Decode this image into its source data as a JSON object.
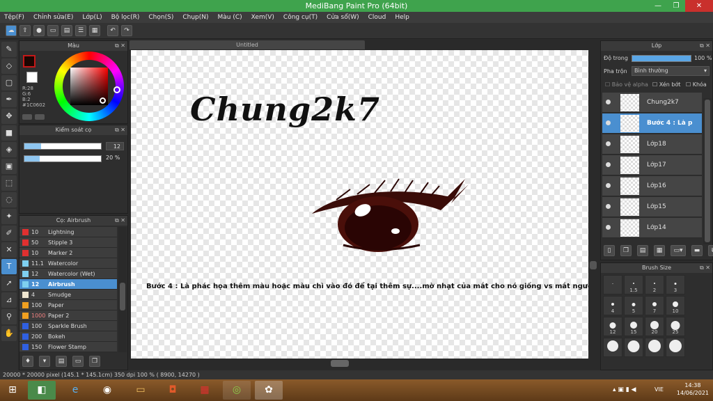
{
  "window": {
    "title": "MediBang Paint Pro (64bit)",
    "min": "—",
    "max": "❐",
    "close": "✕"
  },
  "menu": [
    "Tệp(F)",
    "Chỉnh sửa(E)",
    "Lớp(L)",
    "Bộ lọc(R)",
    "Chọn(S)",
    "Chụp(N)",
    "Màu (C)",
    "Xem(V)",
    "Công cụ(T)",
    "Cửa sổ(W)",
    "Cloud",
    "Help"
  ],
  "toolbar_icons": [
    "cloud-icon",
    "share-icon",
    "comment-icon",
    "chat-icon",
    "page-icon",
    "pages-icon",
    "grid-icon",
    "undo-icon",
    "redo-icon"
  ],
  "color_panel": {
    "title": "Màu",
    "r": "R:28",
    "g": "G:6",
    "b": "B:2",
    "hex": "#1C0602",
    "primary": "#1c0602",
    "accent": "#c41818"
  },
  "brush_control": {
    "title": "Kiểm soát cọ",
    "size_value": "12",
    "size_fraction": 0.22,
    "opacity_value": "20 %",
    "opacity_fraction": 0.2
  },
  "brush_list": {
    "title": "Cọ: Airbrush",
    "items": [
      {
        "size": "10",
        "name": "Lightning",
        "color": "#e03030"
      },
      {
        "size": "50",
        "name": "Stipple 3",
        "color": "#e03030"
      },
      {
        "size": "10",
        "name": "Marker 2",
        "color": "#e03030"
      },
      {
        "size": "11.1",
        "name": "Watercolor",
        "color": "#7fd0f0"
      },
      {
        "size": "12",
        "name": "Watercolor (Wet)",
        "color": "#7fd0f0"
      },
      {
        "size": "12",
        "name": "Airbrush",
        "color": "#7fd0f0"
      },
      {
        "size": "4",
        "name": "Smudge",
        "color": "#f0e6d0"
      },
      {
        "size": "100",
        "name": "Paper",
        "color": "#f0a020"
      },
      {
        "size": "1000",
        "name": "Paper 2",
        "color": "#f0a020"
      },
      {
        "size": "100",
        "name": "Sparkle Brush",
        "color": "#3060e0"
      },
      {
        "size": "200",
        "name": "Bokeh",
        "color": "#3060e0"
      },
      {
        "size": "150",
        "name": "Flower Stamp",
        "color": "#3060e0"
      }
    ]
  },
  "document": {
    "tab": "Untitled",
    "heading_text": "Chung2k7",
    "caption_text": "Bước 4 : Là phác họa thêm màu hoặc màu chì vào đó để tại thêm sự....mờ nhạt của mắt cho nó giống vs mắt người!"
  },
  "layer_panel": {
    "title": "Lớp",
    "opacity_label": "Độ trong",
    "opacity_value": "100 %",
    "opacity_fraction": 1.0,
    "blend_label": "Pha trộn",
    "blend_value": "Bình thường",
    "protect_alpha": "Bảo vệ alpha",
    "clipping": "Xén bớt",
    "lock": "Khóa",
    "layers": [
      "Chung2k7",
      "Bước 4 : Là p",
      "Lớp18",
      "Lớp17",
      "Lớp16",
      "Lớp15",
      "Lớp14"
    ]
  },
  "brush_size": {
    "title": "Brush Size",
    "labels": [
      "",
      "1.5",
      "2",
      "3",
      "4",
      "5",
      "7",
      "10",
      "12",
      "15",
      "20",
      "25",
      "",
      "",
      "",
      ""
    ]
  },
  "status": "20000 * 20000 pixel   (145.1 * 145.1cm)   350 dpi   100 %   ( 8900, 14270 )",
  "taskbar": {
    "lang": "VIE",
    "time": "14:38",
    "date": "14/06/2021"
  }
}
